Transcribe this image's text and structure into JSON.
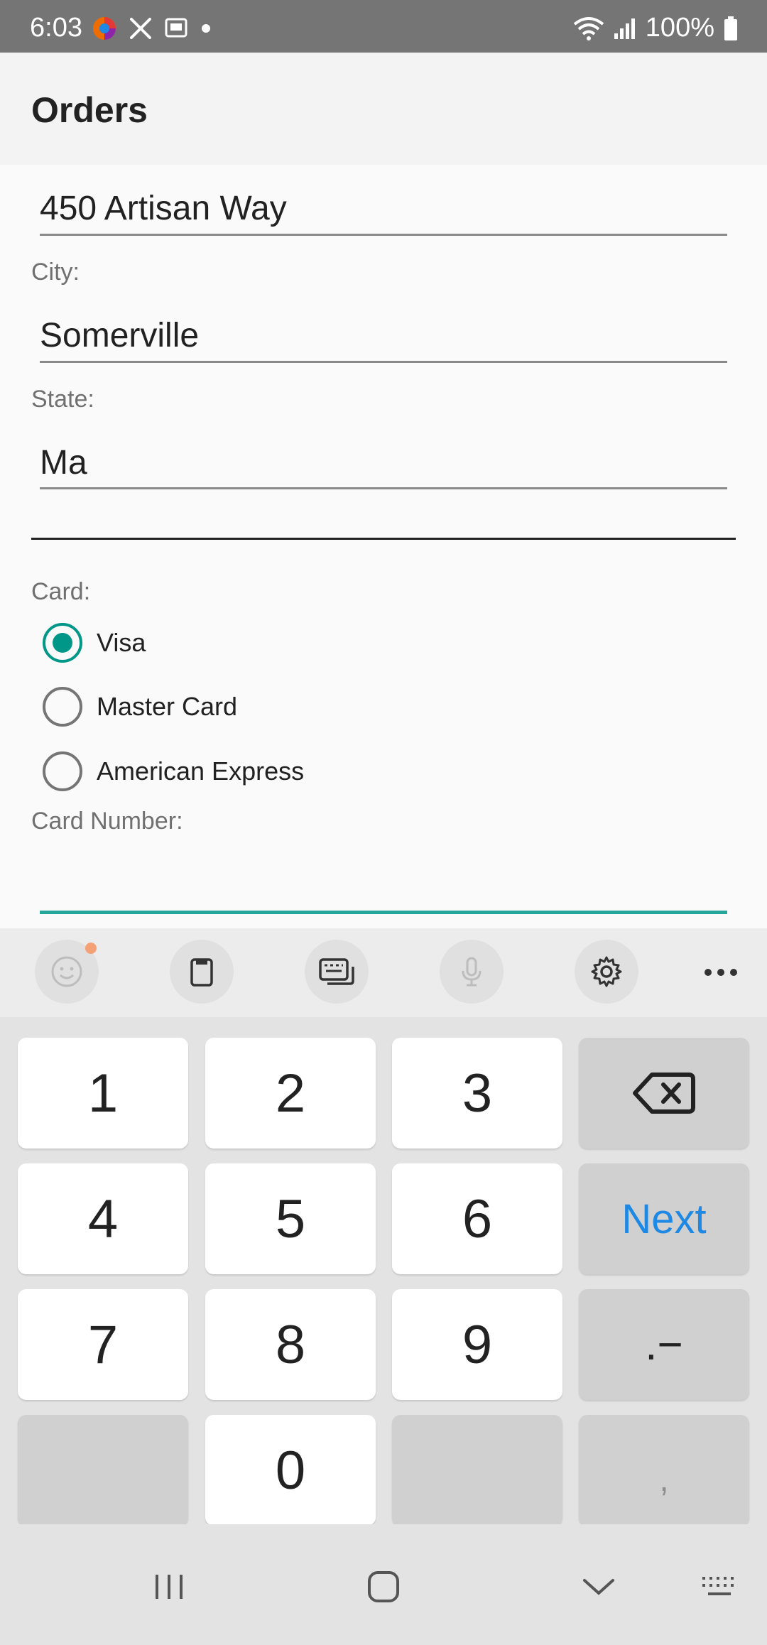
{
  "status_bar": {
    "time": "6:03",
    "battery": "100%"
  },
  "app_bar": {
    "title": "Orders"
  },
  "form": {
    "street_value": "450 Artisan Way",
    "city_label": "City:",
    "city_value": "Somerville",
    "state_label": "State:",
    "state_value": "Ma",
    "card_label": "Card:",
    "card_options": [
      "Visa",
      "Master Card",
      "American Express"
    ],
    "selected_card": "Visa",
    "card_number_label": "Card Number:",
    "card_number_value": ""
  },
  "keyboard": {
    "toolbar_icons": [
      "emoji-icon",
      "clipboard-icon",
      "keyboard-mode-icon",
      "mic-icon",
      "settings-icon",
      "more-icon"
    ],
    "keys": {
      "k1": "1",
      "k2": "2",
      "k3": "3",
      "k4": "4",
      "k5": "5",
      "k6": "6",
      "k7": "7",
      "k8": "8",
      "k9": "9",
      "k0": "0",
      "next": "Next",
      "symbols": ".−",
      "comma": ","
    }
  },
  "colors": {
    "accent": "#009688",
    "next_key": "#1e88e5",
    "status_bar": "#757575"
  }
}
